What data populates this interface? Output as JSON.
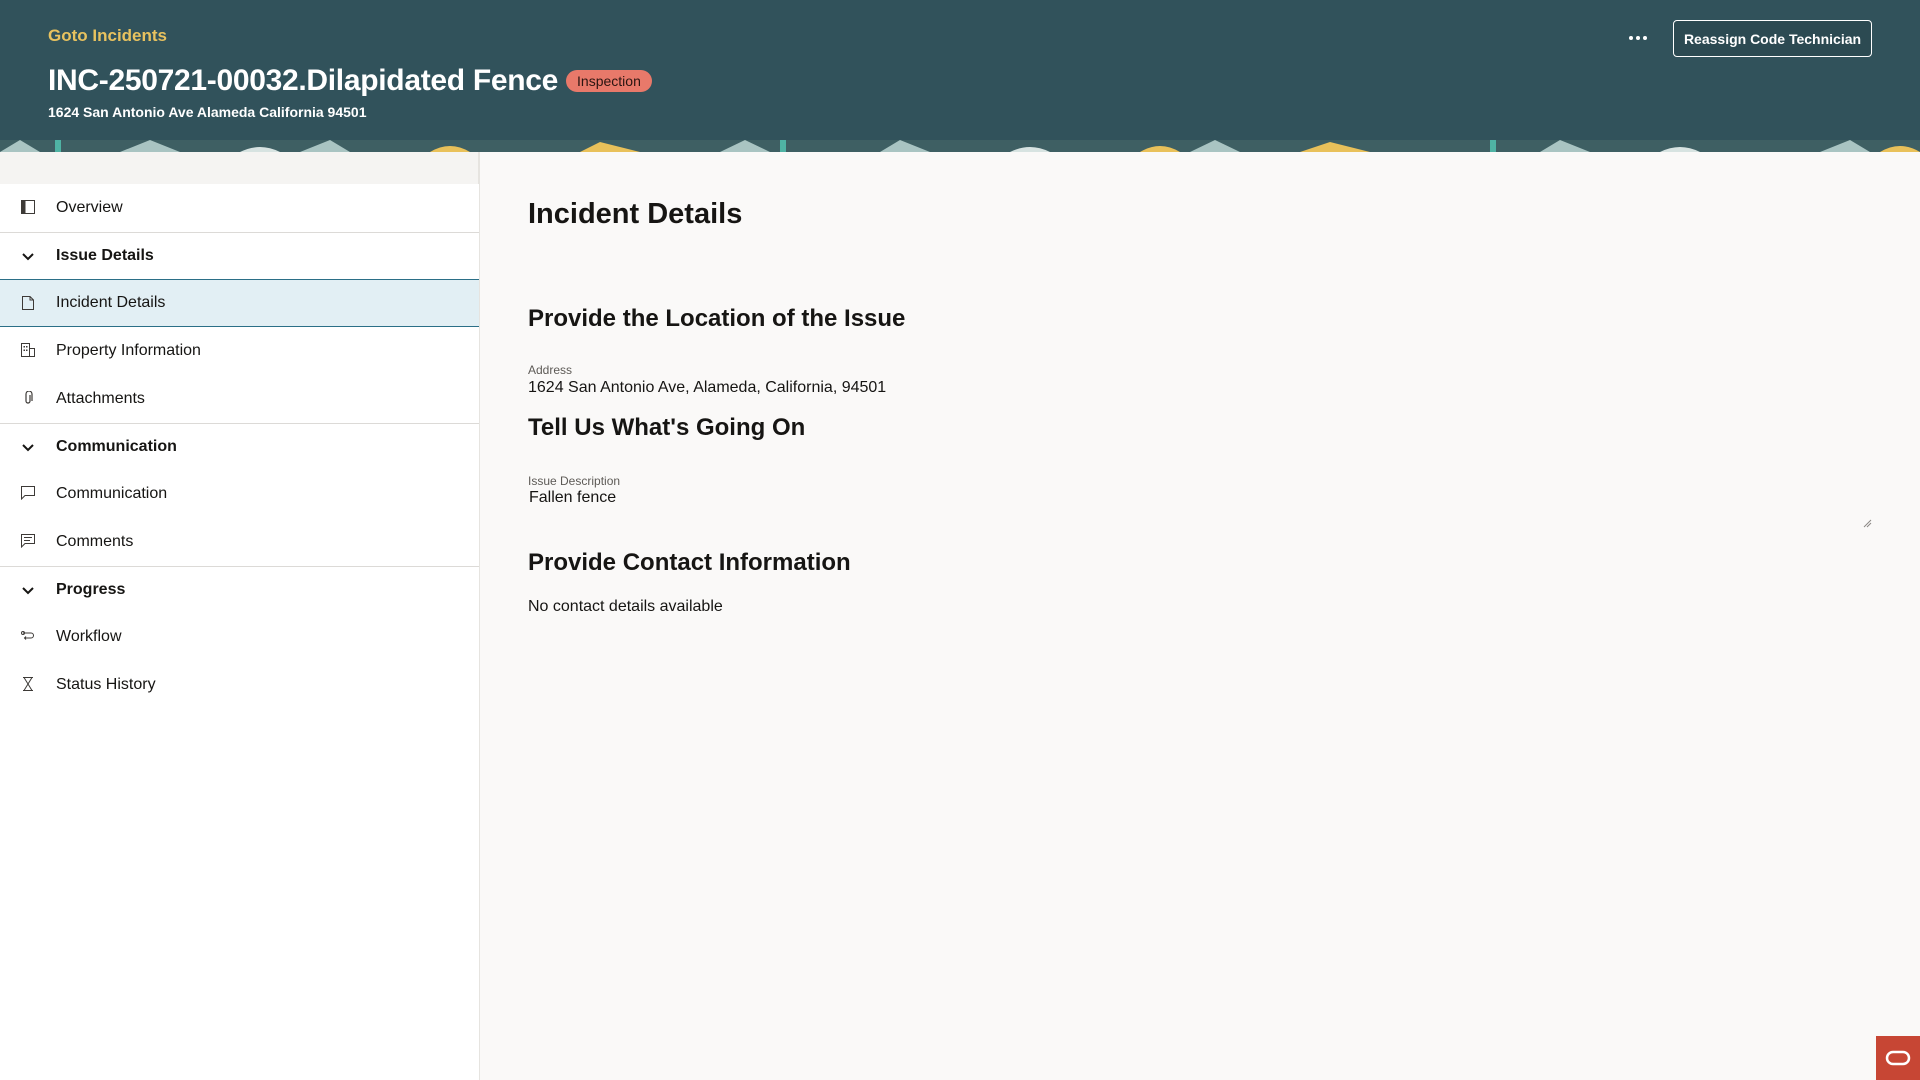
{
  "header": {
    "goto_link": "Goto Incidents",
    "title": "INC-250721-00032.Dilapidated Fence",
    "status_badge": "Inspection",
    "subtitle": "1624 San Antonio Ave Alameda California 94501",
    "more_icon": "more-horizontal-icon",
    "reassign_button": "Reassign Code Technician"
  },
  "sidebar": {
    "items": [
      {
        "label": "Overview",
        "icon": "panel-icon"
      },
      {
        "group": "Issue Details"
      },
      {
        "label": "Incident Details",
        "icon": "document-icon",
        "selected": true
      },
      {
        "label": "Property Information",
        "icon": "building-icon"
      },
      {
        "label": "Attachments",
        "icon": "paperclip-icon"
      },
      {
        "group": "Communication"
      },
      {
        "label": "Communication",
        "icon": "chat-icon"
      },
      {
        "label": "Comments",
        "icon": "comments-icon"
      },
      {
        "group": "Progress"
      },
      {
        "label": "Workflow",
        "icon": "workflow-icon"
      },
      {
        "label": "Status History",
        "icon": "hourglass-icon"
      }
    ],
    "labels": {
      "overview": "Overview",
      "issue_details": "Issue Details",
      "incident_details": "Incident Details",
      "property_information": "Property Information",
      "attachments": "Attachments",
      "communication_group": "Communication",
      "communication": "Communication",
      "comments": "Comments",
      "progress": "Progress",
      "workflow": "Workflow",
      "status_history": "Status History"
    }
  },
  "main": {
    "page_title": "Incident Details",
    "location_heading": "Provide the Location of the Issue",
    "address_label": "Address",
    "address_value": "1624 San Antonio Ave, Alameda, California, 94501",
    "issue_heading": "Tell Us What's Going On",
    "issue_label": "Issue Description",
    "issue_value": "Fallen fence",
    "contact_heading": "Provide Contact Information",
    "contact_value": "No contact details available"
  },
  "colors": {
    "header_bg": "#31525b",
    "goto_link": "#e8c25f",
    "badge_bg": "#e8796a",
    "selected_bg": "#e2eff4",
    "oracle_red": "#c74634"
  }
}
